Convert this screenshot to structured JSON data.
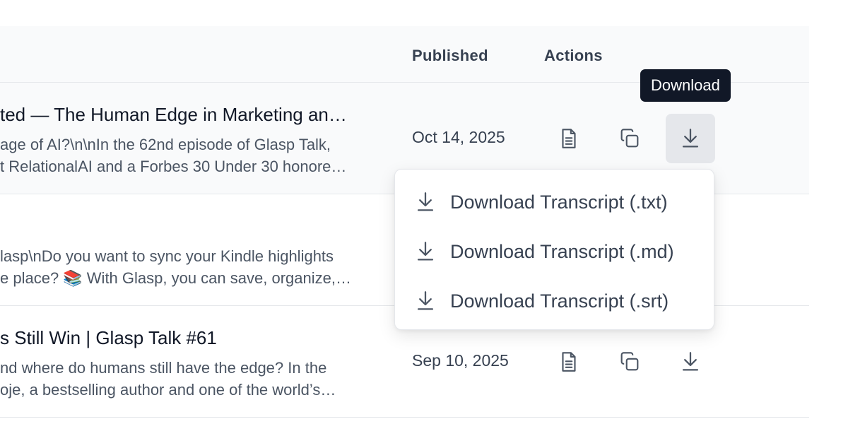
{
  "table": {
    "headers": {
      "published": "Published",
      "actions": "Actions"
    },
    "rows": [
      {
        "title": "ted — The Human Edge in Marketing an…",
        "desc_line1": "age of AI?\\n\\nIn the 62nd episode of Glasp Talk,",
        "desc_line2": "t RelationalAI and a Forbes 30 Under 30 honore…",
        "published": "Oct 14, 2025"
      },
      {
        "title": "",
        "desc_line1": "lasp\\nDo you want to sync your Kindle highlights",
        "desc_line2": "e place? 📚 With Glasp, you can save, organize,…",
        "published": ""
      },
      {
        "title": "s Still Win | Glasp Talk #61",
        "desc_line1": "nd where do humans still have the edge? In the",
        "desc_line2": "oje, a bestselling author and one of the world’s…",
        "published": "Sep 10, 2025"
      }
    ]
  },
  "tooltip": {
    "text": "Download"
  },
  "download_menu": {
    "items": [
      {
        "label": "Download Transcript (.txt)"
      },
      {
        "label": "Download Transcript (.md)"
      },
      {
        "label": "Download Transcript (.srt)"
      }
    ]
  },
  "icons": {
    "view": "document-icon",
    "copy": "copy-icon",
    "download": "download-icon"
  },
  "colors": {
    "header_bg": "#f9fafb",
    "hover_row_bg": "#f9fafb",
    "active_button_bg": "#e5e7eb",
    "tooltip_bg": "#111827",
    "border": "#e5e7eb"
  }
}
